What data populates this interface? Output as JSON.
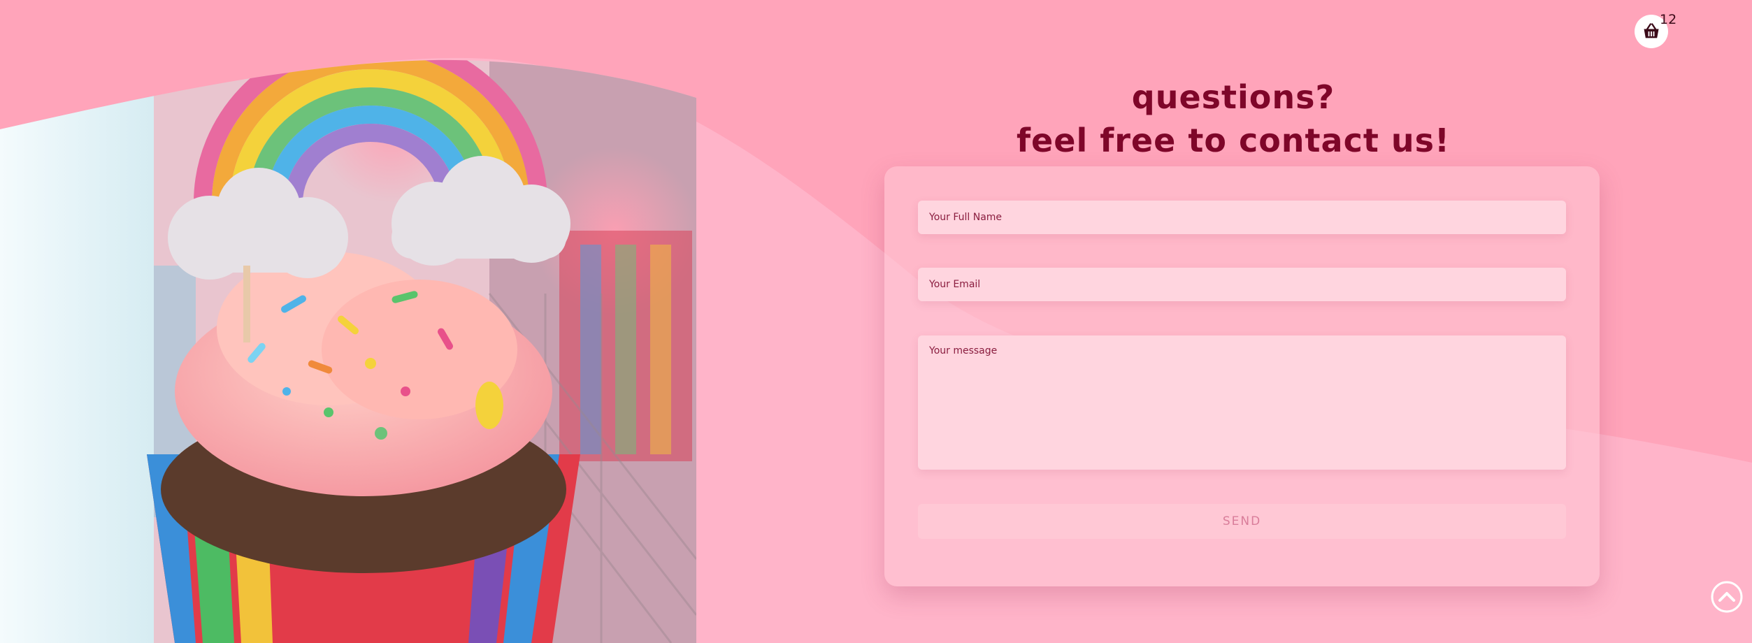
{
  "heading": {
    "line1": "questions?",
    "line2": "feel free to contact us!"
  },
  "form": {
    "name_placeholder": "Your Full Name",
    "email_placeholder": "Your Email",
    "message_placeholder": "Your message",
    "send_label": "SEND"
  },
  "cart": {
    "count": "12",
    "icon": "basket-icon"
  },
  "scroll_top": {
    "icon": "chevron-up-circle-icon"
  },
  "photo": {
    "subject": "cupcake with rainbow topper"
  },
  "colors": {
    "background": "#ffa4ba",
    "wave": "#ffb4c9",
    "heading": "#7e0629",
    "field": "#ffd5df",
    "button": "#ffc8d5"
  }
}
